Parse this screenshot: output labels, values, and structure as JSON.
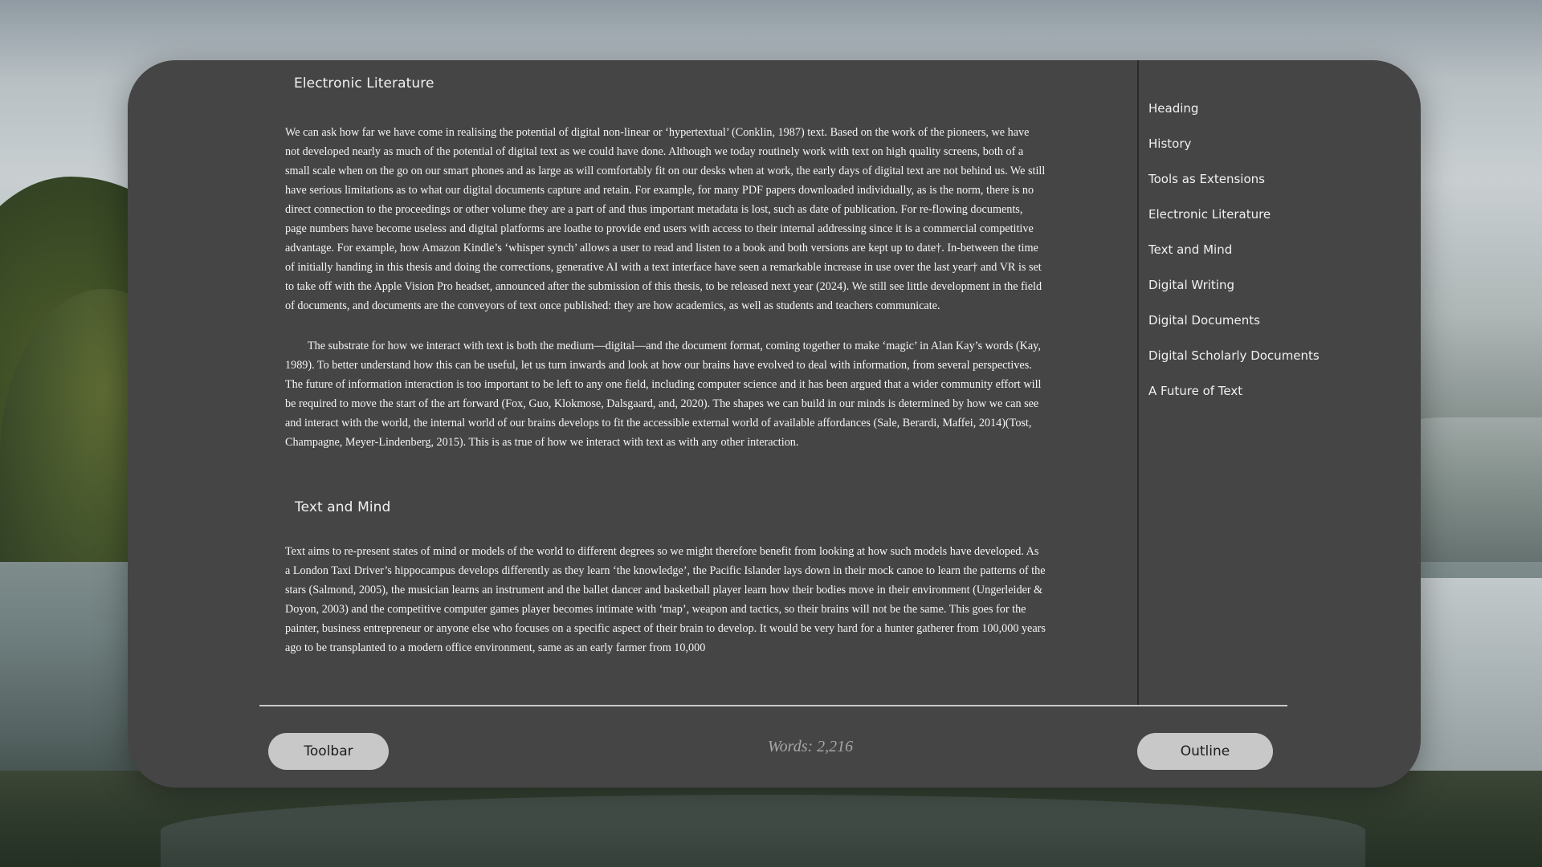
{
  "document": {
    "sections": [
      {
        "heading": "Electronic Literature",
        "paragraphs": [
          "We can ask how far we have come in realising the potential of digital non-linear or ‘hypertextual’ (Conklin, 1987) text. Based on the work of the pioneers, we have not developed nearly as much of the potential of digital text as we could have done. Although we today routinely work with text on high quality screens, both of a small scale when on the go on our smart phones and as large as will comfortably fit on our desks when at work, the early days of digital text are not behind us. We still have serious limitations as to what our digital documents capture and retain. For example, for many PDF papers downloaded individually, as is the norm, there is no direct connection to the proceedings or other volume they are a part of and thus important metadata is lost, such as date of publication. For re-flowing documents, page numbers have become useless and digital platforms are loathe to provide end users with access to their internal addressing since it is a commercial competitive advantage. For example, how Amazon Kindle’s ‘whisper synch’ allows a user to read and listen to a book and both versions are kept up to date†. In-between the time of initially handing in this thesis and doing the corrections, generative AI with a text interface have seen a remarkable increase in use over the last year† and VR is set to take off with the Apple Vision Pro headset, announced after the submission of this thesis, to be released next year (2024). We still see little development in the field of documents, and documents are the conveyors of text once published: they are how academics, as well as students and teachers communicate.",
          "The substrate for how we interact with text is both the medium—digital—and the document format, coming together to make ‘magic’ in Alan Kay’s words (Kay, 1989). To better understand how this can be useful, let us turn inwards and look at how our brains have evolved to deal with information, from several perspectives. The future of information interaction is too important to be left to any one field, including computer science and it has been argued that a wider community effort will be required to move the start of the art forward (Fox, Guo, Klokmose, Dalsgaard, and, 2020). The shapes we can build in our minds is determined by how we can see and interact with the world, the internal world of our brains develops to fit the accessible external world of available affordances (Sale, Berardi, Maffei, 2014)(Tost, Champagne, Meyer-Lindenberg, 2015). This is as true of how we interact with text as with any other interaction."
        ]
      },
      {
        "heading": "Text and Mind",
        "paragraphs": [
          "Text aims to re-present states of mind or models of the world to different degrees so we might therefore benefit from looking at how such models have developed. As a London Taxi Driver’s hippocampus develops differently as they learn ‘the knowledge’, the Pacific Islander lays down in their mock canoe to learn the patterns of the stars (Salmond, 2005), the musician learns an instrument and the ballet dancer and basketball player learn how their bodies move in their environment (Ungerleider & Doyon, 2003) and the competitive computer games player becomes intimate with ‘map’, weapon and tactics, so their brains will not be the same. This goes for the painter, business entrepreneur or anyone else who focuses on a specific aspect of their brain to develop. It would be very hard for a hunter gatherer from 100,000 years ago to be transplanted to a modern office environment, same as an early farmer from 10,000"
        ]
      }
    ]
  },
  "outline": {
    "items": [
      "Heading",
      "History",
      "Tools as Extensions",
      "Electronic Literature",
      "Text and Mind",
      "Digital Writing",
      "Digital Documents",
      "Digital Scholarly Documents",
      "A Future of Text"
    ]
  },
  "footer": {
    "toolbar_label": "Toolbar",
    "word_count": "Words: 2,216",
    "outline_label": "Outline"
  },
  "colors": {
    "window_bg": "#454545",
    "text": "#f4f4f4",
    "button_bg": "#c8c8c8",
    "word_count": "#a6a6a6"
  }
}
